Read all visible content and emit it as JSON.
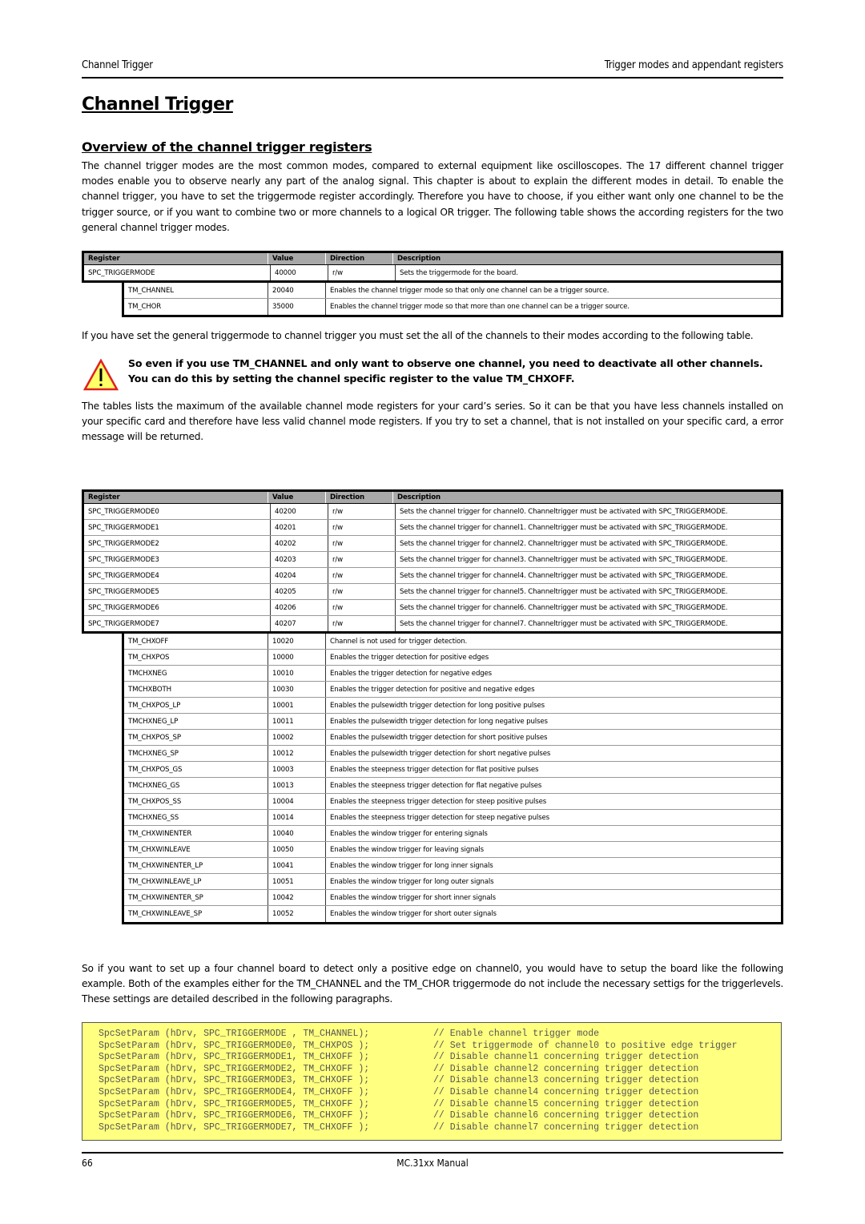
{
  "header": {
    "left": "Channel Trigger",
    "right": "Trigger modes and appendant registers"
  },
  "title": "Channel Trigger",
  "section_title": "Overview of the channel trigger registers",
  "intro_paragraph": "The channel trigger modes are the most common modes, compared to external equipment like oscilloscopes. The 17 different channel trigger modes enable you to observe nearly any part of the analog signal. This chapter is about to explain the different modes in detail. To enable the channel trigger, you have to set the triggermode register accordingly. Therefore you have to choose, if you either want only one channel to be the trigger source, or if you want to combine two or more channels to a logical OR trigger. The following table shows the according registers for the two general channel trigger modes.",
  "table1": {
    "headers": {
      "register": "Register",
      "value": "Value",
      "direction": "Direction",
      "description": "Description"
    },
    "main_rows": [
      {
        "register": "SPC_TRIGGERMODE",
        "value": "40000",
        "direction": "r/w",
        "description": "Sets the triggermode for the board."
      }
    ],
    "sub_rows": [
      {
        "register": "TM_CHANNEL",
        "value": "20040",
        "description": "Enables the channel trigger mode so that only one channel can be a trigger source."
      },
      {
        "register": "TM_CHOR",
        "value": "35000",
        "description": "Enables the channel trigger mode so that more than one channel can be a trigger source."
      }
    ]
  },
  "after_table1_paragraph": "If you have set the general triggermode to channel trigger you must set the all of the channels to their modes according to the following table.",
  "warning": {
    "icon": "warning-triangle-icon",
    "text": "So even if you use TM_CHANNEL and only want to observe one channel, you need to deactivate all other channels. You can do this by setting the channel specific register to the value TM_CHXOFF."
  },
  "tables_paragraph": "The tables lists the maximum of the available channel mode registers for your card’s series. So it can be that you have less channels installed on your specific card and therefore have less valid channel mode registers. If you try to set a channel, that is not installed on your specific card, a error message will be returned.",
  "table2": {
    "headers": {
      "register": "Register",
      "value": "Value",
      "direction": "Direction",
      "description": "Description"
    },
    "main_rows": [
      {
        "register": "SPC_TRIGGERMODE0",
        "value": "40200",
        "direction": "r/w",
        "description": "Sets the channel trigger for channel0. Channeltrigger must be activated with SPC_TRIGGERMODE."
      },
      {
        "register": "SPC_TRIGGERMODE1",
        "value": "40201",
        "direction": "r/w",
        "description": "Sets the channel trigger for channel1. Channeltrigger must be activated with SPC_TRIGGERMODE."
      },
      {
        "register": "SPC_TRIGGERMODE2",
        "value": "40202",
        "direction": "r/w",
        "description": "Sets the channel trigger for channel2. Channeltrigger must be activated with SPC_TRIGGERMODE."
      },
      {
        "register": "SPC_TRIGGERMODE3",
        "value": "40203",
        "direction": "r/w",
        "description": "Sets the channel trigger for channel3. Channeltrigger must be activated with SPC_TRIGGERMODE."
      },
      {
        "register": "SPC_TRIGGERMODE4",
        "value": "40204",
        "direction": "r/w",
        "description": "Sets the channel trigger for channel4. Channeltrigger must be activated with SPC_TRIGGERMODE."
      },
      {
        "register": "SPC_TRIGGERMODE5",
        "value": "40205",
        "direction": "r/w",
        "description": "Sets the channel trigger for channel5. Channeltrigger must be activated with SPC_TRIGGERMODE."
      },
      {
        "register": "SPC_TRIGGERMODE6",
        "value": "40206",
        "direction": "r/w",
        "description": "Sets the channel trigger for channel6. Channeltrigger must be activated with SPC_TRIGGERMODE."
      },
      {
        "register": "SPC_TRIGGERMODE7",
        "value": "40207",
        "direction": "r/w",
        "description": "Sets the channel trigger for channel7. Channeltrigger must be activated with SPC_TRIGGERMODE."
      }
    ],
    "sub_rows": [
      {
        "register": "TM_CHXOFF",
        "value": "10020",
        "description": "Channel is not used for trigger detection."
      },
      {
        "register": "TM_CHXPOS",
        "value": "10000",
        "description": "Enables the trigger detection for positive edges"
      },
      {
        "register": "TMCHXNEG",
        "value": "10010",
        "description": "Enables the trigger detection for negative edges"
      },
      {
        "register": "TMCHXBOTH",
        "value": "10030",
        "description": "Enables the trigger detection for positive and negative edges"
      },
      {
        "register": "TM_CHXPOS_LP",
        "value": "10001",
        "description": "Enables the pulsewidth trigger detection for long positive pulses"
      },
      {
        "register": "TMCHXNEG_LP",
        "value": "10011",
        "description": "Enables the pulsewidth trigger detection for long negative pulses"
      },
      {
        "register": "TM_CHXPOS_SP",
        "value": "10002",
        "description": "Enables the pulsewidth trigger detection for short positive pulses"
      },
      {
        "register": "TMCHXNEG_SP",
        "value": "10012",
        "description": "Enables the pulsewidth trigger detection for short negative pulses"
      },
      {
        "register": "TM_CHXPOS_GS",
        "value": "10003",
        "description": "Enables the steepness trigger detection for flat positive pulses"
      },
      {
        "register": "TMCHXNEG_GS",
        "value": "10013",
        "description": "Enables the steepness trigger detection for flat negative pulses"
      },
      {
        "register": "TM_CHXPOS_SS",
        "value": "10004",
        "description": "Enables the steepness trigger detection for steep positive pulses"
      },
      {
        "register": "TMCHXNEG_SS",
        "value": "10014",
        "description": "Enables the steepness trigger detection for steep negative pulses"
      },
      {
        "register": "TM_CHXWINENTER",
        "value": "10040",
        "description": "Enables the window trigger for entering signals"
      },
      {
        "register": "TM_CHXWINLEAVE",
        "value": "10050",
        "description": "Enables the window trigger for leaving signals"
      },
      {
        "register": "TM_CHXWINENTER_LP",
        "value": "10041",
        "description": "Enables the window trigger for long inner signals"
      },
      {
        "register": "TM_CHXWINLEAVE_LP",
        "value": "10051",
        "description": "Enables the window trigger for long outer signals"
      },
      {
        "register": "TM_CHXWINENTER_SP",
        "value": "10042",
        "description": "Enables the window trigger for short inner signals"
      },
      {
        "register": "TM_CHXWINLEAVE_SP",
        "value": "10052",
        "description": "Enables the window trigger for short outer signals"
      }
    ]
  },
  "example_paragraph": "So if you want to set up a four channel board to detect only a positive edge on channel0, you would have to setup the board like the following example. Both of the examples either for the TM_CHANNEL and the TM_CHOR triggermode do not include the necessary settigs for the triggerlevels. These settings are detailed described in the following paragraphs.",
  "code": {
    "background": "#ffff80",
    "lines": [
      {
        "stmt": "SpcSetParam (hDrv, SPC_TRIGGERMODE , TM_CHANNEL);",
        "comment": "// Enable channel trigger mode"
      },
      {
        "stmt": "SpcSetParam (hDrv, SPC_TRIGGERMODE0, TM_CHXPOS );",
        "comment": "// Set triggermode of channel0 to positive edge trigger"
      },
      {
        "stmt": "SpcSetParam (hDrv, SPC_TRIGGERMODE1, TM_CHXOFF );",
        "comment": "// Disable channel1 concerning trigger detection"
      },
      {
        "stmt": "SpcSetParam (hDrv, SPC_TRIGGERMODE2, TM_CHXOFF );",
        "comment": "// Disable channel2 concerning trigger detection"
      },
      {
        "stmt": "SpcSetParam (hDrv, SPC_TRIGGERMODE3, TM_CHXOFF );",
        "comment": "// Disable channel3 concerning trigger detection"
      },
      {
        "stmt": "SpcSetParam (hDrv, SPC_TRIGGERMODE4, TM_CHXOFF );",
        "comment": "// Disable channel4 concerning trigger detection"
      },
      {
        "stmt": "SpcSetParam (hDrv, SPC_TRIGGERMODE5, TM_CHXOFF );",
        "comment": "// Disable channel5 concerning trigger detection"
      },
      {
        "stmt": "SpcSetParam (hDrv, SPC_TRIGGERMODE6, TM_CHXOFF );",
        "comment": "// Disable channel6 concerning trigger detection"
      },
      {
        "stmt": "SpcSetParam (hDrv, SPC_TRIGGERMODE7, TM_CHXOFF );",
        "comment": "// Disable channel7 concerning trigger detection"
      }
    ]
  },
  "footer": {
    "page_number": "66",
    "manual_title": "MC.31xx Manual"
  }
}
